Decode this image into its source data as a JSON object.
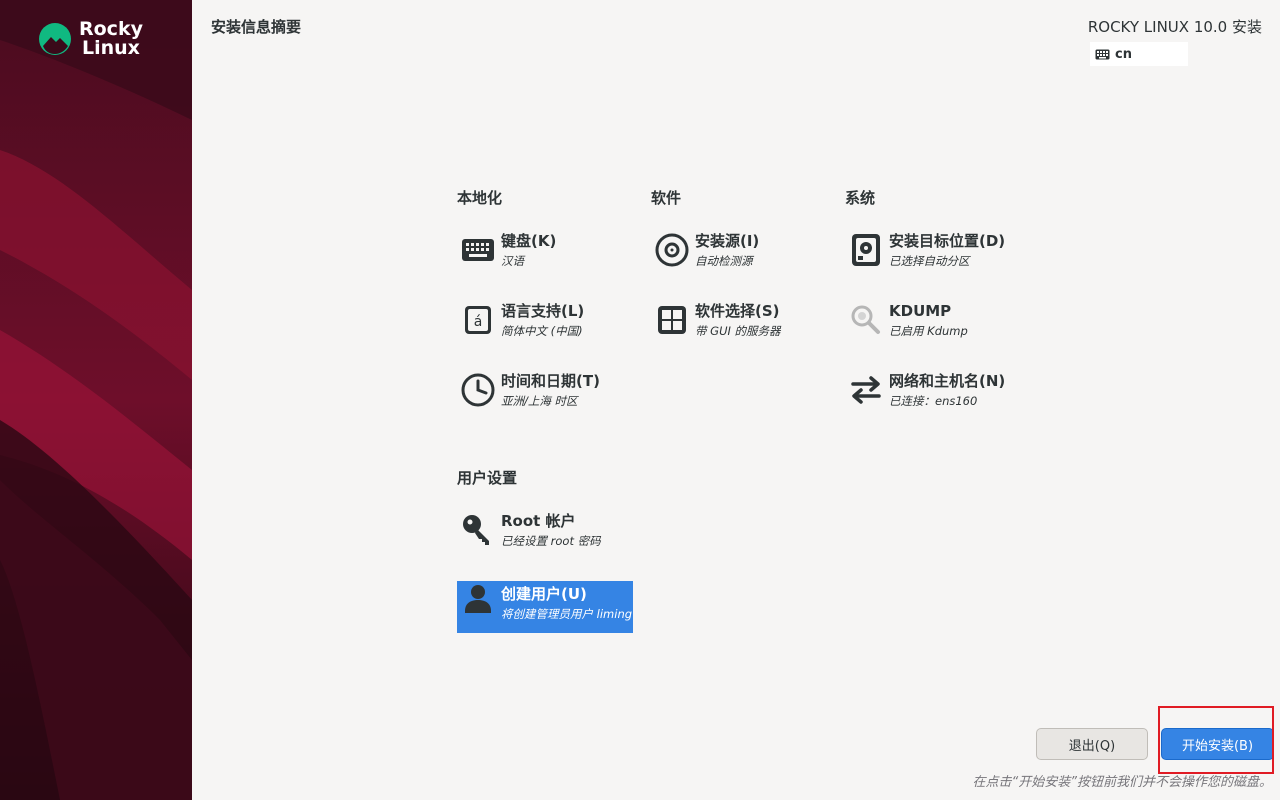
{
  "sidebar": {
    "logo_line1": "Rocky",
    "logo_line2": "Linux"
  },
  "header": {
    "page_title": "安装信息摘要",
    "product_title": "ROCKY LINUX 10.0 安装",
    "keyboard_layout": "cn"
  },
  "categories": {
    "localization": "本地化",
    "software": "软件",
    "system": "系统",
    "user_settings": "用户设置"
  },
  "spokes": {
    "keyboard": {
      "title": "键盘(K)",
      "status": "汉语",
      "icon": "keyboard-icon"
    },
    "language": {
      "title": "语言支持(L)",
      "status": "简体中文 (中国)",
      "icon": "language-icon"
    },
    "datetime": {
      "title": "时间和日期(T)",
      "status": "亚洲/上海 时区",
      "icon": "clock-icon"
    },
    "source": {
      "title": "安装源(I)",
      "status": "自动检测源",
      "icon": "disc-icon"
    },
    "software": {
      "title": "软件选择(S)",
      "status": "带 GUI 的服务器",
      "icon": "package-icon"
    },
    "destination": {
      "title": "安装目标位置(D)",
      "status": "已选择自动分区",
      "icon": "hard-disk-icon"
    },
    "kdump": {
      "title": "KDUMP",
      "status": "已启用 Kdump",
      "icon": "magnifier-icon"
    },
    "network": {
      "title": "网络和主机名(N)",
      "status": "已连接：ens160",
      "icon": "network-transmit-receive-icon"
    },
    "root": {
      "title": "Root 帐户",
      "status": "已经设置 root 密码",
      "icon": "key-icon"
    },
    "user": {
      "title": "创建用户(U)",
      "status": "将创建管理员用户 liming",
      "icon": "user-icon"
    }
  },
  "buttons": {
    "quit": "退出(Q)",
    "begin": "开始安装(B)"
  },
  "footer": {
    "note": "在点击“开始安装”按钮前我们并不会操作您的磁盘。"
  },
  "colors": {
    "accent": "#3584e4",
    "sidebar": "#3a0a1a",
    "background": "#f6f5f4",
    "logo_green": "#10b981",
    "highlight": "#e01b24"
  }
}
